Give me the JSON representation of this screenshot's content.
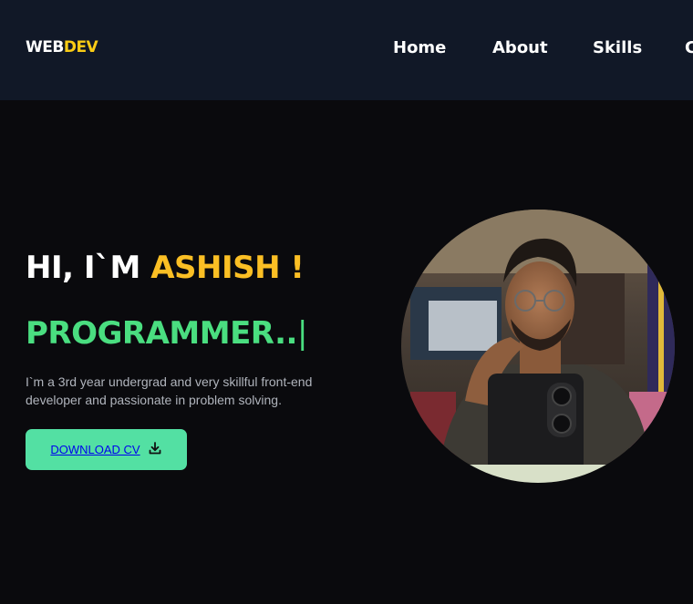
{
  "navbar": {
    "logo_prefix": "WEB",
    "logo_suffix": "DEV",
    "links": [
      "Home",
      "About",
      "Skills",
      "C"
    ]
  },
  "hero": {
    "greeting_prefix": "HI, I`M ",
    "name": "ASHISH !",
    "role": "PROGRAMMER..",
    "cursor": "|",
    "description": "I`m a 3rd year undergrad and very skillful front-end developer and passionate in problem solving.",
    "button_label": "DOWNLOAD CV",
    "button_icon": "download-icon",
    "image_icon": "profile-photo"
  },
  "colors": {
    "navbar_bg": "#111827",
    "page_bg": "#0a0a0d",
    "accent_yellow": "#fbbf24",
    "accent_green": "#4ade80",
    "button_bg": "#53e0a3"
  }
}
